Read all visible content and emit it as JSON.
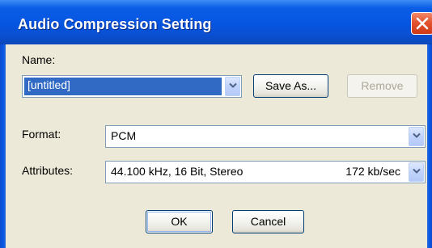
{
  "window": {
    "title": "Audio Compression Setting",
    "close_icon": "close-icon"
  },
  "name_section": {
    "label": "Name:",
    "value": "[untitled]",
    "save_as_label": "Save As...",
    "remove_label": "Remove",
    "remove_enabled": false
  },
  "format": {
    "label": "Format:",
    "value": "PCM"
  },
  "attributes": {
    "label": "Attributes:",
    "value": "44.100 kHz, 16 Bit, Stereo",
    "rate": "172 kb/sec"
  },
  "buttons": {
    "ok_label": "OK",
    "cancel_label": "Cancel"
  },
  "colors": {
    "titlebar": "#0655e0",
    "client_bg": "#ece9d8",
    "selection": "#316ac5",
    "close_button": "#e4532f"
  }
}
